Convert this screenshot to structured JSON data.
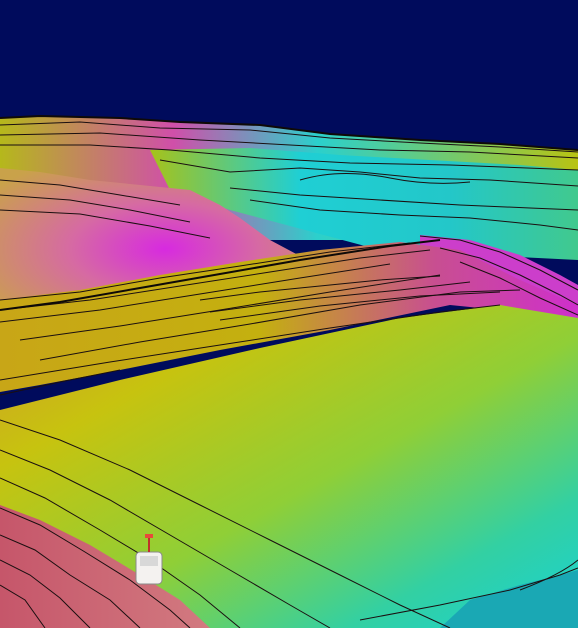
{
  "scene": {
    "sky_color": "#000b5c",
    "palette": {
      "magenta": "#d21ee0",
      "pink": "#d86b8f",
      "rose": "#c85a74",
      "yellow": "#c4c70d",
      "olive": "#b7b90f",
      "green": "#5cc96a",
      "teal": "#1ad0c6",
      "cyan": "#19d9df",
      "contour": "#1a0f10"
    }
  }
}
